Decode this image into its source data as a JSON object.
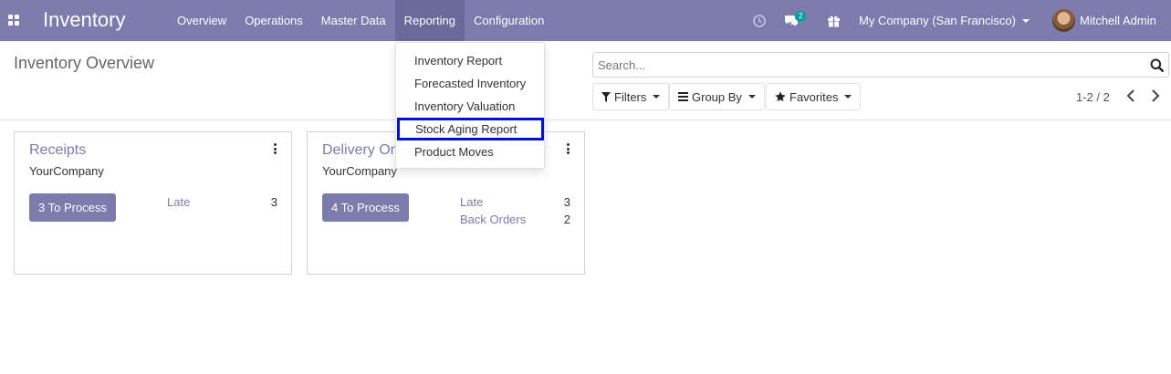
{
  "navbar": {
    "brand": "Inventory",
    "menu": [
      "Overview",
      "Operations",
      "Master Data",
      "Reporting",
      "Configuration"
    ],
    "chat_count": "2",
    "company": "My Company (San Francisco)",
    "user": "Mitchell Admin"
  },
  "control_panel": {
    "title": "Inventory Overview",
    "search_placeholder": "Search...",
    "filters_label": "Filters",
    "groupby_label": "Group By",
    "favorites_label": "Favorites",
    "pager": "1-2 / 2"
  },
  "reporting_menu": {
    "items": [
      "Inventory Report",
      "Forecasted Inventory",
      "Inventory Valuation",
      "Stock Aging Report",
      "Product Moves"
    ],
    "highlight_color": "#0010d8"
  },
  "cards": [
    {
      "title": "Receipts",
      "company": "YourCompany",
      "button": "3 To Process",
      "stats": [
        {
          "label": "Late",
          "value": "3"
        }
      ]
    },
    {
      "title": "Delivery Orders",
      "company": "YourCompany",
      "button": "4 To Process",
      "stats": [
        {
          "label": "Late",
          "value": "3"
        },
        {
          "label": "Back Orders",
          "value": "2"
        }
      ]
    }
  ],
  "colors": {
    "brand": "#7c7bad",
    "badge": "#00a09d"
  }
}
